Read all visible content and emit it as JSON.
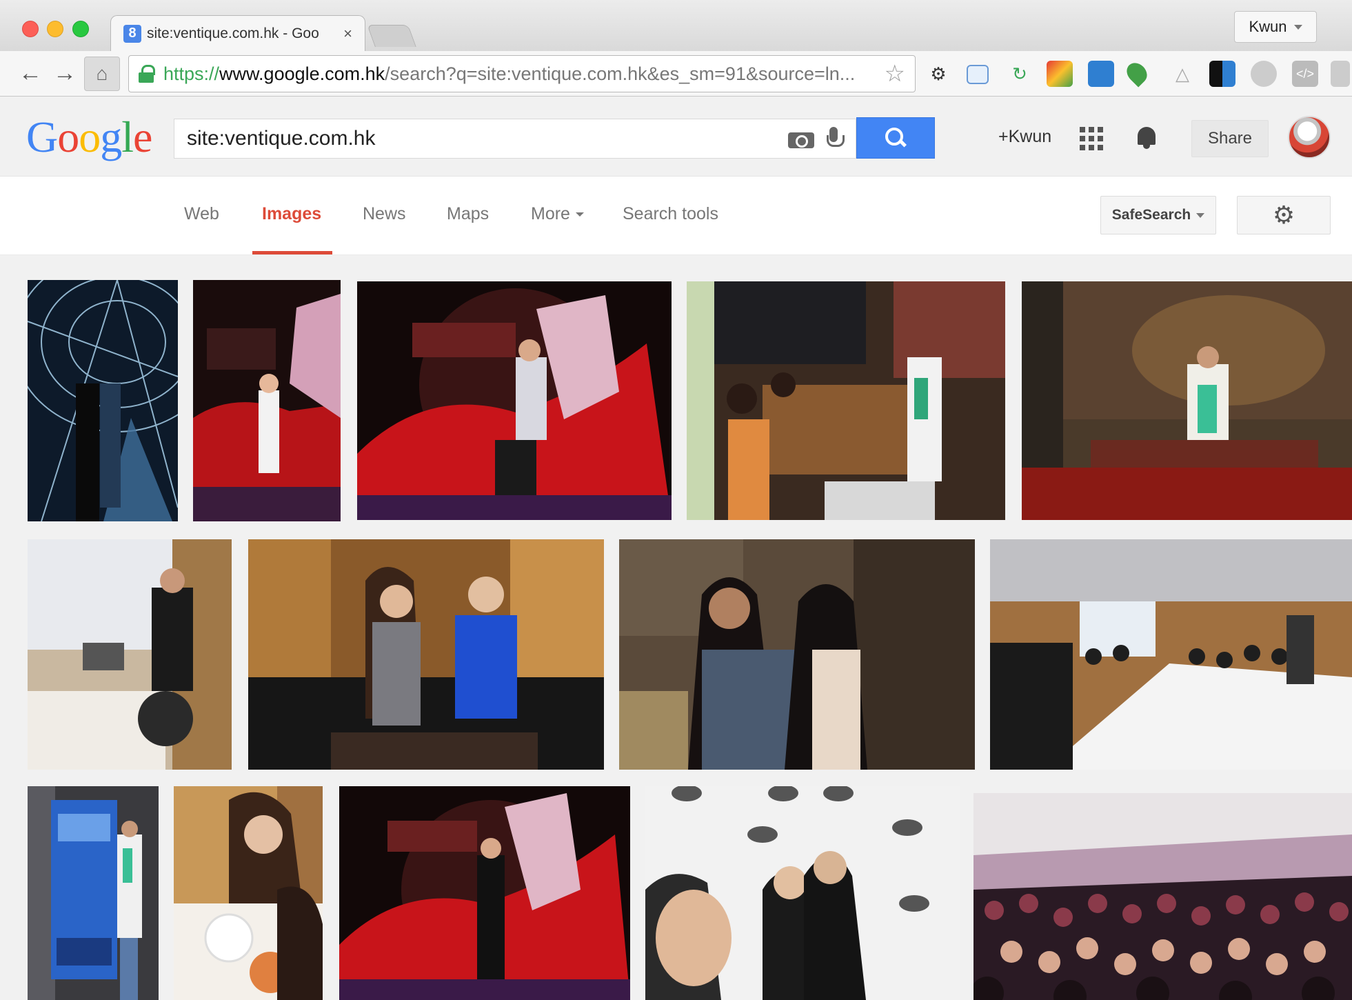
{
  "browser": {
    "tab": {
      "favicon": "8",
      "title": "site:ventique.com.hk - Goo",
      "close": "×"
    },
    "profile": "Kwun",
    "url": {
      "scheme": "https://",
      "host": "www.google.com.hk",
      "path": "/search?q=site:ventique.com.hk&es_sm=91&source=ln..."
    },
    "extensions": [
      "settings-gear-icon",
      "window-icon",
      "refresh-green-icon",
      "color-picker-icon",
      "chat-icon",
      "map-pin-icon",
      "bell-outline-icon",
      "qr-icon",
      "globe-icon",
      "code-icon"
    ]
  },
  "google": {
    "logo": [
      "G",
      "o",
      "o",
      "g",
      "l",
      "e"
    ],
    "query": "site:ventique.com.hk",
    "plus_user": "+Kwun",
    "share": "Share"
  },
  "nav": {
    "tabs": [
      "Web",
      "Images",
      "News",
      "Maps",
      "More",
      "Search tools"
    ],
    "active_tab": "Images",
    "safesearch": "SafeSearch"
  },
  "images": {
    "count": 14,
    "colors": {
      "accent_red": "#dd4b39",
      "search_blue": "#4285f4",
      "secure_green": "#3aa757"
    }
  }
}
